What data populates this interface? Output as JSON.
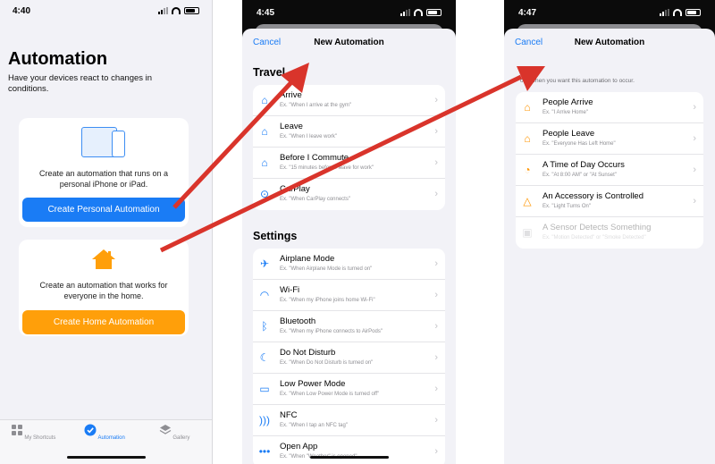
{
  "screen1": {
    "time": "4:40",
    "title": "Automation",
    "subtitle": "Have your devices react to changes in conditions.",
    "personal": {
      "description": "Create an automation that runs on a personal iPhone or iPad.",
      "button": "Create Personal Automation"
    },
    "home": {
      "description": "Create an automation that works for everyone in the home.",
      "button": "Create Home Automation"
    },
    "tabs": [
      {
        "label": "My Shortcuts"
      },
      {
        "label": "Automation"
      },
      {
        "label": "Gallery"
      }
    ]
  },
  "screen2": {
    "time": "4:45",
    "cancel": "Cancel",
    "title": "New Automation",
    "travel_header": "Travel",
    "travel": [
      {
        "label": "Arrive",
        "example": "Ex. \"When I arrive at the gym\""
      },
      {
        "label": "Leave",
        "example": "Ex. \"When I leave work\""
      },
      {
        "label": "Before I Commute",
        "example": "Ex. \"15 minutes before I leave for work\""
      },
      {
        "label": "CarPlay",
        "example": "Ex. \"When CarPlay connects\""
      }
    ],
    "settings_header": "Settings",
    "settings": [
      {
        "label": "Airplane Mode",
        "example": "Ex. \"When Airplane Mode is turned on\""
      },
      {
        "label": "Wi-Fi",
        "example": "Ex. \"When my iPhone joins home Wi-Fi\""
      },
      {
        "label": "Bluetooth",
        "example": "Ex. \"When my iPhone connects to AirPods\""
      },
      {
        "label": "Do Not Disturb",
        "example": "Ex. \"When Do Not Disturb is turned on\""
      },
      {
        "label": "Low Power Mode",
        "example": "Ex. \"When Low Power Mode is turned off\""
      },
      {
        "label": "NFC",
        "example": "Ex. \"When I tap an NFC tag\""
      },
      {
        "label": "Open App",
        "example": "Ex. \"When \"Weather\" is opened\""
      }
    ]
  },
  "screen3": {
    "time": "4:47",
    "cancel": "Cancel",
    "title": "New Automation",
    "hint": "ose when you want this automation to occur.",
    "items": [
      {
        "label": "People Arrive",
        "example": "Ex. \"I Arrive Home\""
      },
      {
        "label": "People Leave",
        "example": "Ex. \"Everyone Has Left Home\""
      },
      {
        "label": "A Time of Day Occurs",
        "example": "Ex. \"At 8:00 AM\" or \"At Sunset\""
      },
      {
        "label": "An Accessory is Controlled",
        "example": "Ex. \"Light Turns On\""
      },
      {
        "label": "A Sensor Detects Something",
        "example": "Ex. \"Motion Detected\" or \"Smoke Detected\""
      }
    ]
  },
  "colors": {
    "accent_blue": "#1a7cf5",
    "home_orange": "#ff9f0a",
    "arrow_red": "#d9342b"
  }
}
